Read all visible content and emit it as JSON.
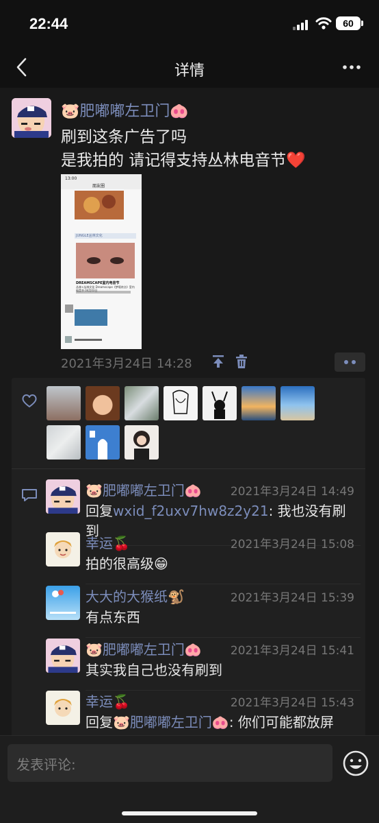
{
  "status": {
    "time": "22:44",
    "battery": "60"
  },
  "nav": {
    "title": "详情"
  },
  "post": {
    "author": "🐷肥嘟嘟左卫门🐽",
    "text_line1": "刷到这条广告了吗",
    "text_line2": "是我拍的 请记得支持丛林电音节❤️",
    "timestamp": "2021年3月24日 14:28",
    "image": {
      "time": "13:00",
      "title": "朋友圈",
      "brand": "JUNGLE丛林文化",
      "headline": "DREAMSCAPE室内电音节",
      "caption": "丛林×丛林文化 Dreamscape《梦境终点》室内电音节 04月03日"
    }
  },
  "comments": [
    {
      "name": "🐷肥嘟嘟左卫门🐽",
      "time": "2021年3月24日 14:49",
      "text_prefix": "回复",
      "reply_to": "wxid_f2uxv7hw8z2y21",
      "text": ": 我也没有刷到"
    },
    {
      "name": "幸运🍒",
      "time": "2021年3月24日 15:08",
      "text": "拍的很高级😁"
    },
    {
      "name": "大大的大猴纸🐒",
      "time": "2021年3月24日 15:39",
      "text": "有点东西"
    },
    {
      "name": "🐷肥嘟嘟左卫门🐽",
      "time": "2021年3月24日 15:41",
      "text": "其实我自己也没有刷到"
    },
    {
      "name": "幸运🍒",
      "time": "2021年3月24日 15:43",
      "text_prefix": "回复",
      "reply_to": "🐷肥嘟嘟左卫门🐽",
      "text": ": 你们可能都放屏"
    }
  ],
  "input": {
    "placeholder": "发表评论:"
  },
  "colors": {
    "link": "#7c8dbb",
    "background": "#111111",
    "panel": "#202020"
  },
  "icons": [
    "back-icon",
    "more-icon",
    "pin-top-icon",
    "trash-icon",
    "heart-outline-icon",
    "comment-icon",
    "emoji-icon"
  ]
}
